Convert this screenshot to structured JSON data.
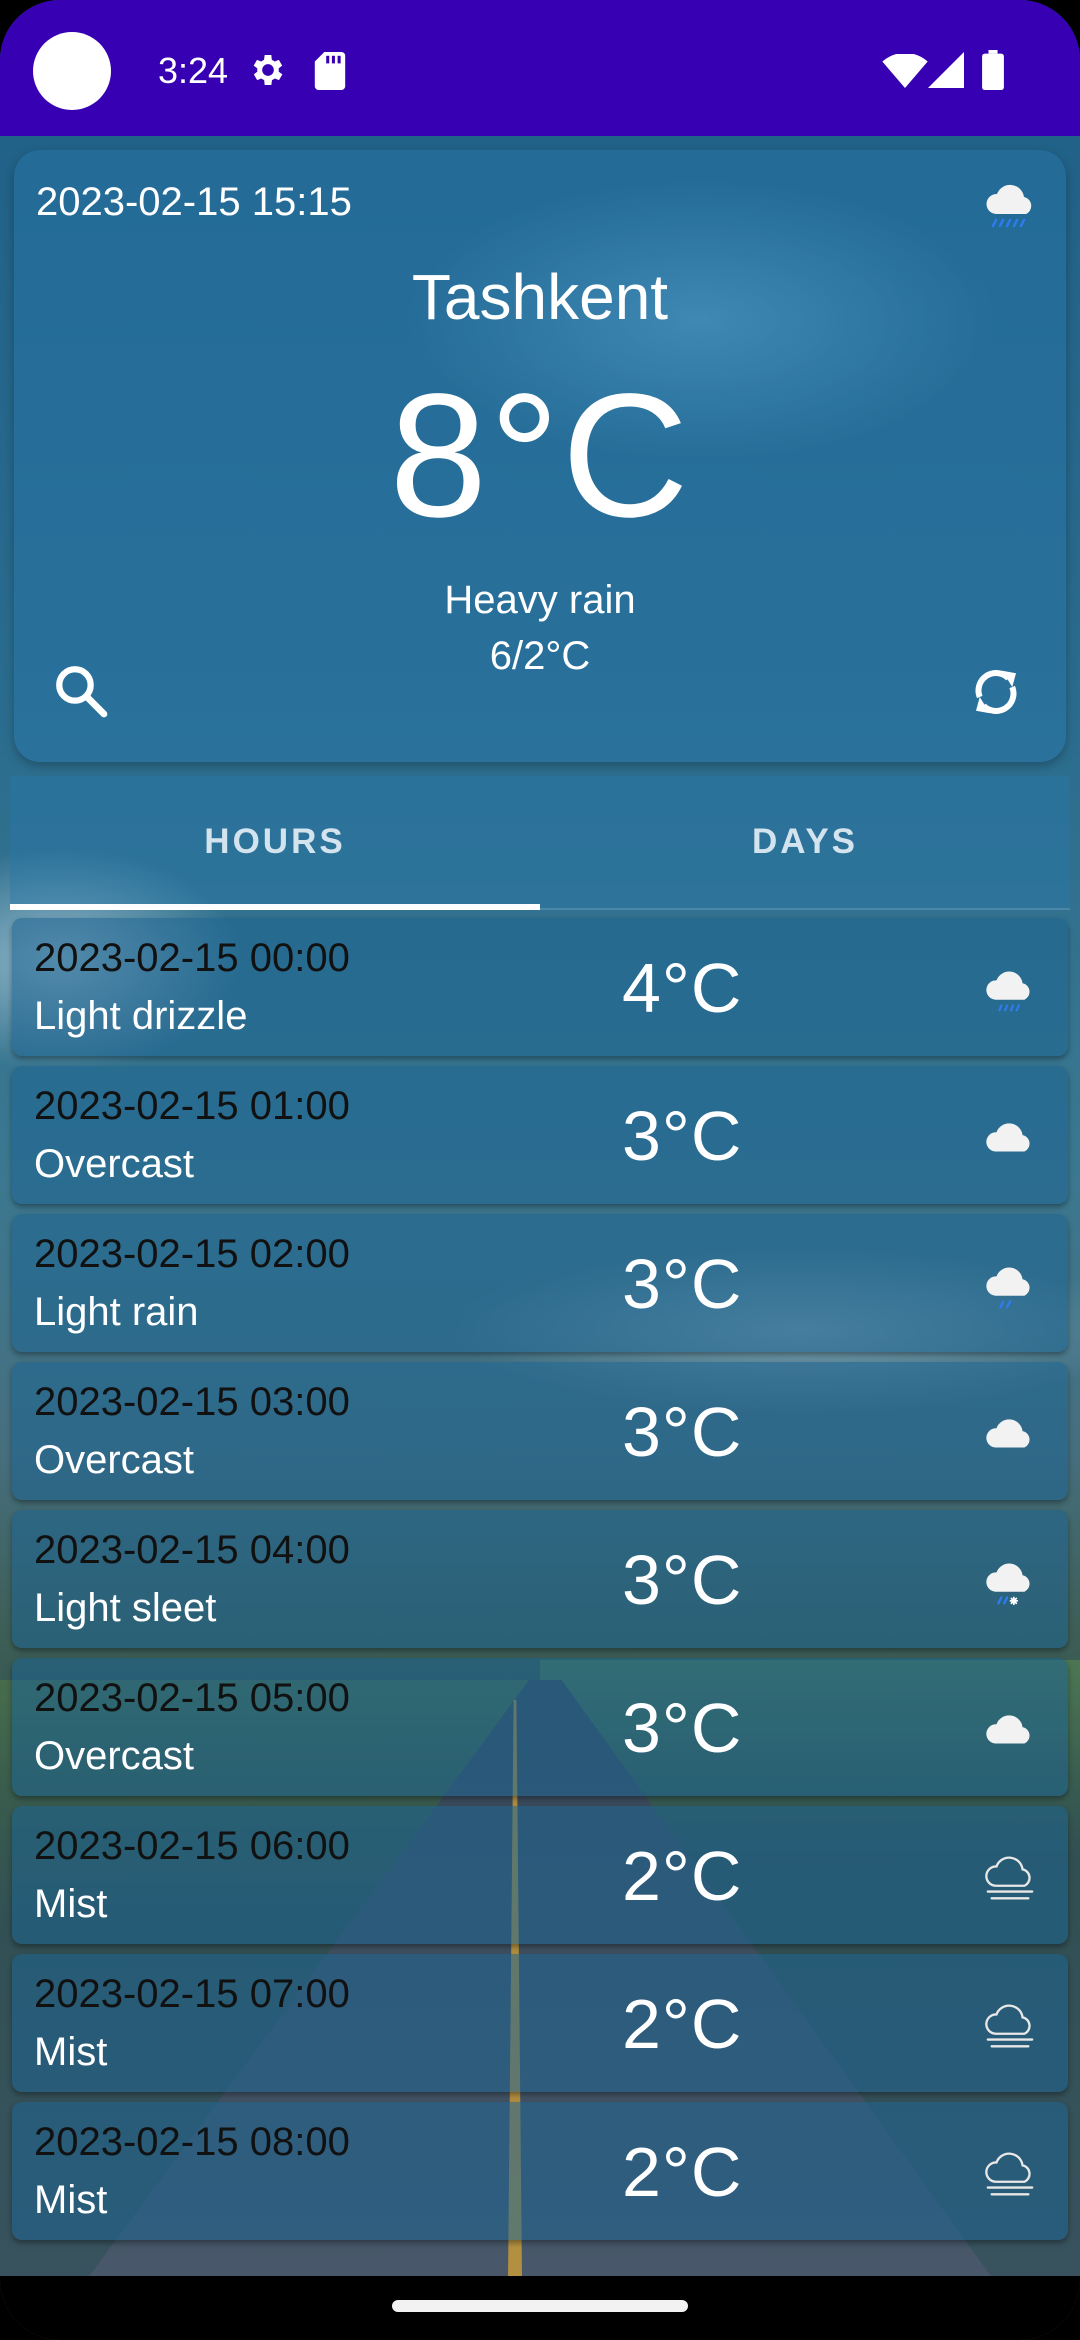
{
  "status_bar": {
    "time": "3:24",
    "icons": [
      "gear-icon",
      "sd-card-icon",
      "wifi-icon",
      "cell-signal-icon",
      "battery-icon"
    ]
  },
  "current": {
    "datetime": "2023-02-15 15:15",
    "city": "Tashkent",
    "temperature": "8°C",
    "condition": "Heavy rain",
    "min_max": "6/2°C",
    "condition_icon": "heavy-rain-cloud-icon"
  },
  "tabs": [
    {
      "label": "HOURS",
      "selected": true
    },
    {
      "label": "DAYS",
      "selected": false
    }
  ],
  "hourly": [
    {
      "time": "2023-02-15 00:00",
      "condition": "Light drizzle",
      "temp": "4°C",
      "icon": "drizzle-cloud-icon"
    },
    {
      "time": "2023-02-15 01:00",
      "condition": "Overcast",
      "temp": "3°C",
      "icon": "overcast-cloud-icon"
    },
    {
      "time": "2023-02-15 02:00",
      "condition": "Light rain",
      "temp": "3°C",
      "icon": "light-rain-cloud-icon"
    },
    {
      "time": "2023-02-15 03:00",
      "condition": "Overcast",
      "temp": "3°C",
      "icon": "overcast-cloud-icon"
    },
    {
      "time": "2023-02-15 04:00",
      "condition": "Light sleet",
      "temp": "3°C",
      "icon": "sleet-cloud-icon"
    },
    {
      "time": "2023-02-15 05:00",
      "condition": "Overcast",
      "temp": "3°C",
      "icon": "overcast-cloud-icon"
    },
    {
      "time": "2023-02-15 06:00",
      "condition": "Mist",
      "temp": "2°C",
      "icon": "mist-cloud-icon"
    },
    {
      "time": "2023-02-15 07:00",
      "condition": "Mist",
      "temp": "2°C",
      "icon": "mist-cloud-icon"
    },
    {
      "time": "2023-02-15 08:00",
      "condition": "Mist",
      "temp": "2°C",
      "icon": "mist-cloud-icon"
    }
  ],
  "colors": {
    "status_bar": "#3700b3",
    "rain_drop": "#2e7cf0",
    "text_dark": "#111111"
  }
}
